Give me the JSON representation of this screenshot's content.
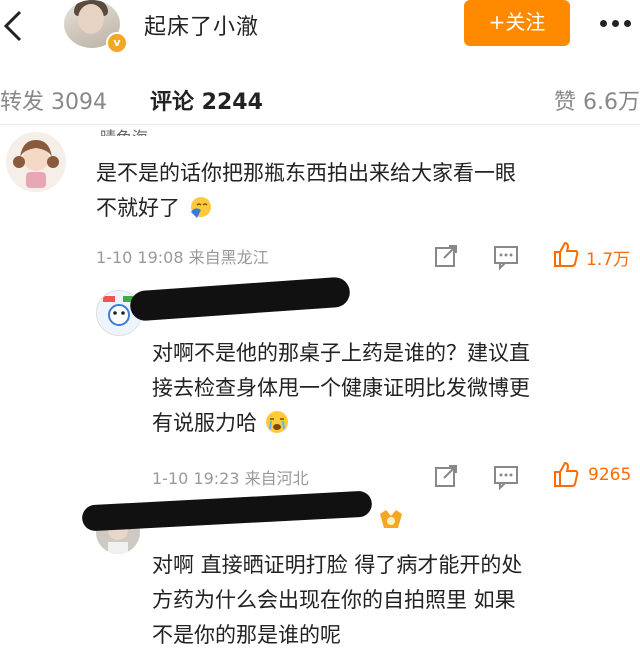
{
  "header": {
    "title": "起床了小澈",
    "follow_label": "+关注",
    "verified_badge": "v"
  },
  "tabs": {
    "repost": "转发 3094",
    "comments": "评论 2244",
    "likes": "赞 6.6万"
  },
  "comments": [
    {
      "name_partial": "晴色海",
      "text_line1": "是不是的话你把那瓶东西拍出来给大家看一眼",
      "text_line2": "不就好了",
      "time": "1-10 19:08",
      "source": "来自黑龙江",
      "likes": "1.7万"
    },
    {
      "text_line1": "对啊不是他的那桌子上药是谁的？建议直",
      "text_line2": "接去检查身体甩一个健康证明比发微博更",
      "text_line3": "有说服力哈",
      "time": "1-10 19:23",
      "source": "来自河北",
      "likes": "9265"
    },
    {
      "text_line1": "对啊 直接晒证明打脸 得了病才能开的处",
      "text_line2": "方药为什么会出现在你的自拍照里 如果",
      "text_line3": "不是你的那是谁的呢"
    }
  ],
  "colors": {
    "accent": "#ff8a00",
    "like": "#ff6a00",
    "meta": "#999999"
  },
  "icons": [
    "back-arrow-icon",
    "more-icon",
    "share-icon",
    "comment-icon",
    "like-icon",
    "emoji-icon"
  ]
}
